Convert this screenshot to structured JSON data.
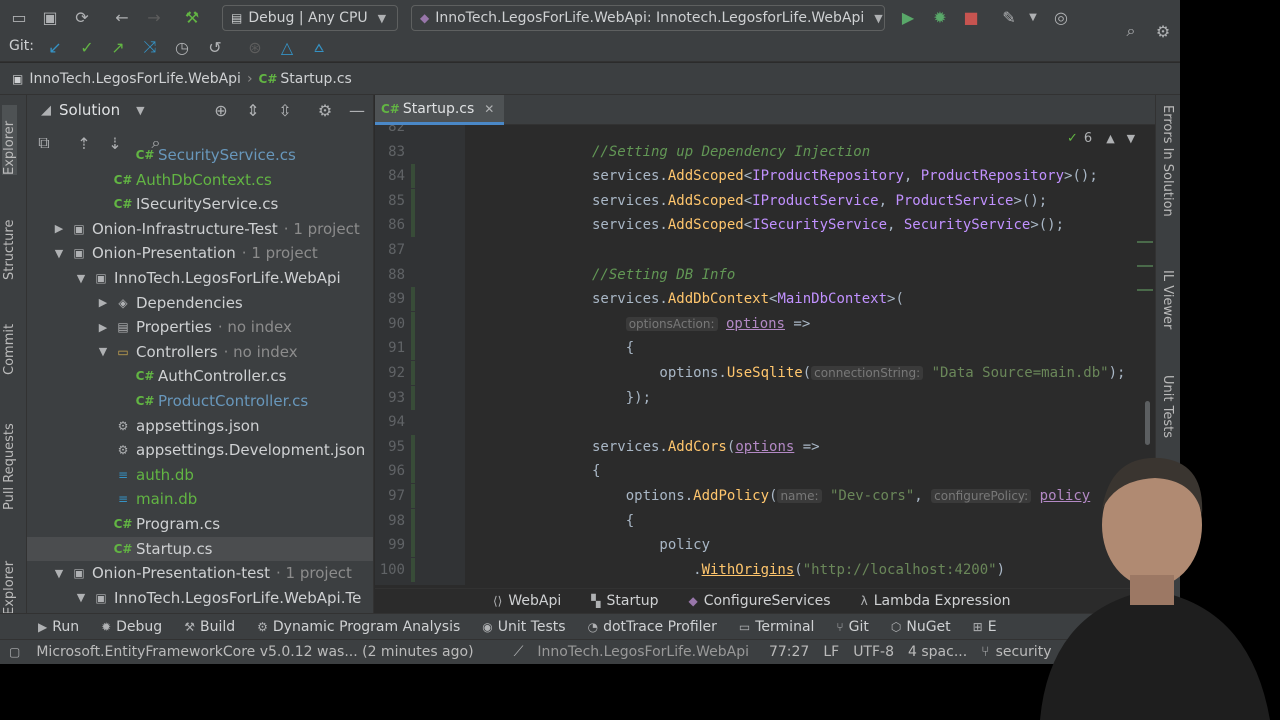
{
  "toolbar": {
    "config_combo": "Debug | Any CPU",
    "run_combo": "InnoTech.LegosForLife.WebApi: Innotech.LegosforLife.WebApi",
    "git_label": "Git:"
  },
  "breadcrumb": {
    "project": "InnoTech.LegosForLife.WebApi",
    "file": "Startup.cs",
    "file_lang": "C#"
  },
  "left_tabs": [
    "Explorer",
    "Structure",
    "Commit",
    "Pull Requests",
    "Explorer"
  ],
  "right_tabs": [
    "Errors In Solution",
    "IL Viewer",
    "Unit Tests"
  ],
  "solution": {
    "title": "Solution",
    "tree": [
      {
        "indent": 4,
        "arrow": "",
        "icon": "C#",
        "label": "SecurityService.cs",
        "muted": "",
        "style": "blue"
      },
      {
        "indent": 3,
        "arrow": "",
        "icon": "C#",
        "label": "AuthDbContext.cs",
        "muted": "",
        "style": "green"
      },
      {
        "indent": 3,
        "arrow": "",
        "icon": "C#",
        "label": "ISecurityService.cs",
        "muted": "",
        "style": ""
      },
      {
        "indent": 1,
        "arrow": "▶",
        "icon": "▣",
        "label": "Onion-Infrastructure-Test",
        "muted": "· 1 project",
        "style": ""
      },
      {
        "indent": 1,
        "arrow": "▼",
        "icon": "▣",
        "label": "Onion-Presentation",
        "muted": "· 1 project",
        "style": ""
      },
      {
        "indent": 2,
        "arrow": "▼",
        "icon": "▣",
        "label": "InnoTech.LegosForLife.WebApi",
        "muted": "",
        "style": ""
      },
      {
        "indent": 3,
        "arrow": "▶",
        "icon": "◈",
        "label": "Dependencies",
        "muted": "",
        "style": ""
      },
      {
        "indent": 3,
        "arrow": "▶",
        "icon": "▤",
        "label": "Properties",
        "muted": "· no index",
        "style": ""
      },
      {
        "indent": 3,
        "arrow": "▼",
        "icon": "▭",
        "label": "Controllers",
        "muted": "· no index",
        "style": ""
      },
      {
        "indent": 4,
        "arrow": "",
        "icon": "C#",
        "label": "AuthController.cs",
        "muted": "",
        "style": ""
      },
      {
        "indent": 4,
        "arrow": "",
        "icon": "C#",
        "label": "ProductController.cs",
        "muted": "",
        "style": "blue"
      },
      {
        "indent": 3,
        "arrow": "",
        "icon": "⚙",
        "label": "appsettings.json",
        "muted": "",
        "style": ""
      },
      {
        "indent": 3,
        "arrow": "",
        "icon": "⚙",
        "label": "appsettings.Development.json",
        "muted": "",
        "style": ""
      },
      {
        "indent": 3,
        "arrow": "",
        "icon": "≡",
        "label": "auth.db",
        "muted": "",
        "style": "green"
      },
      {
        "indent": 3,
        "arrow": "",
        "icon": "≡",
        "label": "main.db",
        "muted": "",
        "style": "green"
      },
      {
        "indent": 3,
        "arrow": "",
        "icon": "C#",
        "label": "Program.cs",
        "muted": "",
        "style": ""
      },
      {
        "indent": 3,
        "arrow": "",
        "icon": "C#",
        "label": "Startup.cs",
        "muted": "",
        "style": "selected"
      },
      {
        "indent": 1,
        "arrow": "▼",
        "icon": "▣",
        "label": "Onion-Presentation-test",
        "muted": "· 1 project",
        "style": ""
      },
      {
        "indent": 2,
        "arrow": "▼",
        "icon": "▣",
        "label": "InnoTech.LegosForLife.WebApi.Te",
        "muted": "",
        "style": ""
      }
    ]
  },
  "editor": {
    "tab_label": "Startup.cs",
    "tab_lang": "C#",
    "inspection_count": "6",
    "lines": [
      {
        "n": "82",
        "html": ""
      },
      {
        "n": "83",
        "html": "<span class=\"cm\">//Setting up Dependency Injection</span>"
      },
      {
        "n": "84",
        "html": "services.<span class=\"fn\">AddScoped</span>&lt;<span class=\"ty\">IProductRepository</span>, <span class=\"ty\">ProductRepository</span>&gt;();"
      },
      {
        "n": "85",
        "html": "services.<span class=\"fn\">AddScoped</span>&lt;<span class=\"ty\">IProductService</span>, <span class=\"ty\">ProductService</span>&gt;();"
      },
      {
        "n": "86",
        "html": "services.<span class=\"fn\">AddScoped</span>&lt;<span class=\"ty\">ISecurityService</span>, <span class=\"ty\">SecurityService</span>&gt;();"
      },
      {
        "n": "87",
        "html": ""
      },
      {
        "n": "88",
        "html": "<span class=\"cm\">//Setting DB Info</span>"
      },
      {
        "n": "89",
        "html": "services.<span class=\"fn\">AddDbContext</span>&lt;<span class=\"ty\">MainDbContext</span>&gt;("
      },
      {
        "n": "90",
        "html": "    <span class=\"hint\">optionsAction:</span> <span class=\"pm\" style=\"text-decoration:underline\">options</span> =&gt;"
      },
      {
        "n": "91",
        "html": "    {"
      },
      {
        "n": "92",
        "html": "        options.<span class=\"fn\">UseSqlite</span>(<span class=\"hint\">connectionString:</span> <span class=\"st\">\"Data Source=main.db\"</span>);"
      },
      {
        "n": "93",
        "html": "    });"
      },
      {
        "n": "94",
        "html": ""
      },
      {
        "n": "95",
        "html": "services.<span class=\"fn\">AddCors</span>(<span class=\"pm\" style=\"text-decoration:underline\">options</span> =&gt;"
      },
      {
        "n": "96",
        "html": "{"
      },
      {
        "n": "97",
        "html": "    options.<span class=\"fn\">AddPolicy</span>(<span class=\"hint\">name:</span> <span class=\"st\">\"Dev-cors\"</span>, <span class=\"hint\">configurePolicy:</span> <span class=\"pm\" style=\"text-decoration:underline\">policy</span>"
      },
      {
        "n": "98",
        "html": "    {"
      },
      {
        "n": "99",
        "html": "        policy"
      },
      {
        "n": "100",
        "html": "            .<span class=\"fn\" style=\"text-decoration:underline\">WithOrigins</span>(<span class=\"st\">\"http://localhost:4200\"</span>)"
      }
    ]
  },
  "editor_breadcrumb": [
    "WebApi",
    "Startup",
    "ConfigureServices",
    "Lambda Expression"
  ],
  "tool_tabs": [
    "Run",
    "Debug",
    "Build",
    "Dynamic Program Analysis",
    "Unit Tests",
    "dotTrace Profiler",
    "Terminal",
    "Git",
    "NuGet",
    "E"
  ],
  "status": {
    "message": "Microsoft.EntityFrameworkCore v5.0.12 was... (2 minutes ago)",
    "project": "InnoTech.LegosForLife.WebApi",
    "position": "77:27",
    "line_sep": "LF",
    "encoding": "UTF-8",
    "indent": "4 spac...",
    "branch": "security"
  },
  "colors": {
    "bg": "#2b2b2b",
    "panel": "#3c3f41",
    "comment": "#629755",
    "method": "#ffc66d",
    "type": "#c191ff",
    "string": "#6a8759"
  }
}
